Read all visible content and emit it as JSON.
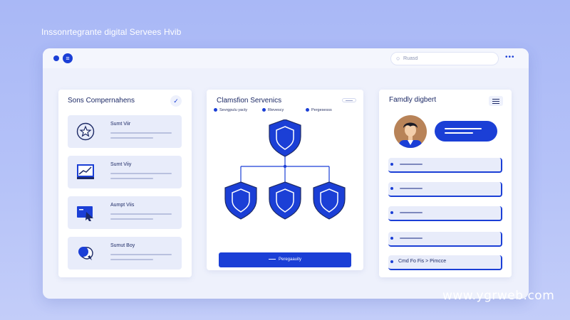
{
  "hub": {
    "title": "Inssonrtegrante digital Servees Hvib"
  },
  "topbar": {
    "menu_glyph": "≡",
    "search_placeholder": "Ruasd",
    "search_icon": "search-icon",
    "more_glyph": "•••"
  },
  "left_panel": {
    "title": "Sons Compernahens",
    "check_glyph": "✓",
    "cards": [
      {
        "label": "Sumt Viir",
        "icon": "star-badge-icon"
      },
      {
        "label": "Sumt Viiy",
        "icon": "monitor-chart-icon"
      },
      {
        "label": "Aumpt Viis",
        "icon": "cursor-window-icon"
      },
      {
        "label": "Sumut Boy",
        "icon": "chat-bubble-icon"
      }
    ]
  },
  "mid_panel": {
    "title": "Clamsfion Servenics",
    "legend": [
      "Sevrgpulu yacty",
      "Rievescy",
      "Pergesesss"
    ],
    "button_label": "Peregaauity",
    "icon": "shield-icon"
  },
  "right_panel": {
    "title": "Famdly digbert",
    "avatar_icon": "avatar-icon",
    "rows": [
      {
        "text": ""
      },
      {
        "text": ""
      },
      {
        "text": ""
      },
      {
        "text": ""
      },
      {
        "text": "Cmd Fo Fis  >  Pimcce"
      }
    ]
  },
  "watermark": "www.ygrweb.com",
  "colors": {
    "accent": "#1b3fd6",
    "background": "#b5c2f8",
    "panel": "#ffffff",
    "card": "#e8ecfa",
    "text": "#1d2a66"
  }
}
